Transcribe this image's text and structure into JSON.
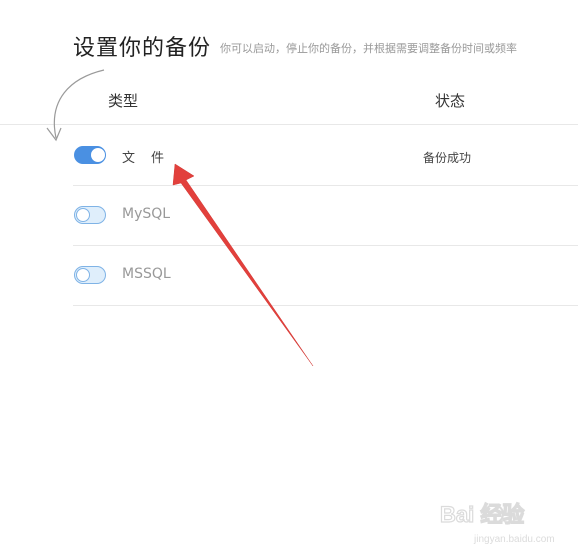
{
  "header": {
    "title": "设置你的备份",
    "subtitle": "你可以启动，停止你的备份，并根据需要调整备份时间或频率"
  },
  "table": {
    "columns": [
      "类型",
      "状态"
    ],
    "rows": [
      {
        "label": "文件",
        "enabled": true,
        "status": "备份成功"
      },
      {
        "label": "MySQL",
        "enabled": false,
        "status": ""
      },
      {
        "label": "MSSQL",
        "enabled": false,
        "status": ""
      }
    ]
  },
  "watermark": {
    "text": "Bai 经验",
    "url": "jingyan.baidu.com"
  },
  "colors": {
    "accent": "#4a90e2",
    "annotation_arrow": "#e2403c"
  }
}
